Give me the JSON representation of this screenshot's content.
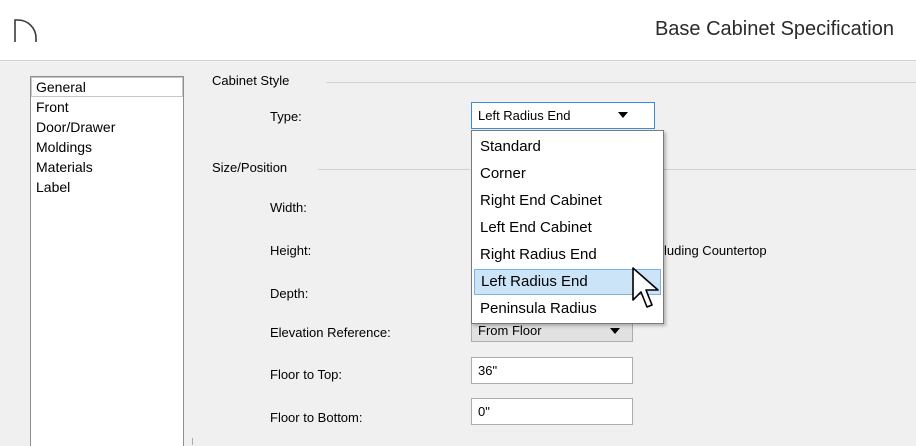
{
  "window": {
    "title": "Base Cabinet Specification",
    "app_icon": "radius-arc-icon"
  },
  "sidebar": {
    "items": [
      {
        "label": "General",
        "selected": true
      },
      {
        "label": "Front"
      },
      {
        "label": "Door/Drawer"
      },
      {
        "label": "Moldings"
      },
      {
        "label": "Materials"
      },
      {
        "label": "Label"
      }
    ]
  },
  "cabinet_style": {
    "group_label": "Cabinet Style",
    "type_label": "Type:",
    "type_value": "Left Radius End",
    "options": [
      "Standard",
      "Corner",
      "Right End Cabinet",
      "Left End Cabinet",
      "Right Radius End",
      "Left Radius End",
      "Peninsula Radius"
    ],
    "highlighted": "Left Radius End"
  },
  "size_position": {
    "group_label": "Size/Position",
    "width_label": "Width:",
    "height_label": "Height:",
    "height_suffix": "luding Countertop",
    "depth_label": "Depth:",
    "elevation_label": "Elevation Reference:",
    "elevation_value": "From Floor",
    "floor_to_top_label": "Floor to Top:",
    "floor_to_top_value": "36\"",
    "floor_to_bottom_label": "Floor to Bottom:",
    "floor_to_bottom_value": "0\""
  },
  "colors": {
    "highlight": "#cce4f7",
    "focus_border": "#3c8bd8"
  }
}
